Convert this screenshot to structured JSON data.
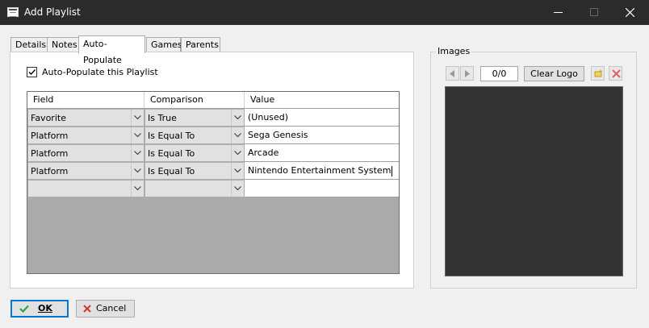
{
  "window": {
    "title": "Add Playlist",
    "title_color": "#2b2b2b"
  },
  "tabs": [
    {
      "label": "Details"
    },
    {
      "label": "Notes"
    },
    {
      "label": "Auto-Populate",
      "active": true
    },
    {
      "label": "Games"
    },
    {
      "label": "Parents"
    }
  ],
  "auto_populate": {
    "checkbox_label": "Auto-Populate this Playlist",
    "checked": true,
    "columns": [
      "Field",
      "Comparison",
      "Value"
    ],
    "rows": [
      {
        "field": "Favorite",
        "comparison": "Is True",
        "value": "(Unused)"
      },
      {
        "field": "Platform",
        "comparison": "Is Equal To",
        "value": "Sega Genesis"
      },
      {
        "field": "Platform",
        "comparison": "Is Equal To",
        "value": "Arcade"
      },
      {
        "field": "Platform",
        "comparison": "Is Equal To",
        "value": "Nintendo Entertainment System"
      },
      {
        "field": "",
        "comparison": "",
        "value": ""
      }
    ]
  },
  "images": {
    "group_label": "Images",
    "counter": "0/0",
    "clear_logo_label": "Clear Logo",
    "icons": [
      "arrow-left-icon",
      "arrow-right-icon",
      "add-image-icon",
      "delete-image-icon"
    ]
  },
  "buttons": {
    "ok_label": "OK",
    "cancel_label": "Cancel",
    "accent": "#0078d7"
  }
}
